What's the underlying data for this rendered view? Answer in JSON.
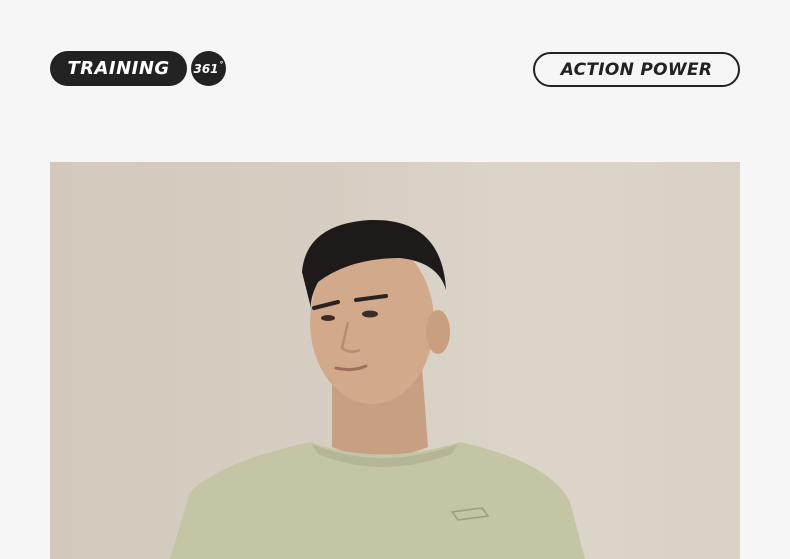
{
  "header": {
    "training_label": "TRAINING",
    "logo_text": "361",
    "logo_degree": "°",
    "action_label": "ACTION POWER"
  },
  "colors": {
    "background": "#f6f6f6",
    "badge_dark": "#222222",
    "photo_backdrop": "#d7cfc3",
    "shirt": "#c5c6a6"
  }
}
